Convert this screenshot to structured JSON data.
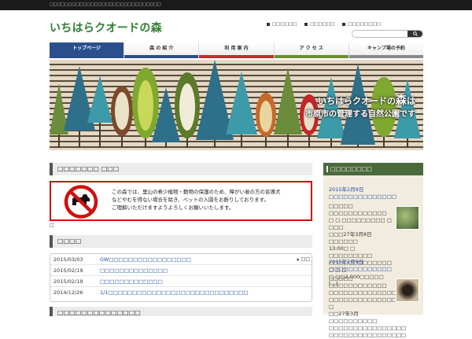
{
  "topbar": {
    "text": "□□□□□□□□□□□□□□□□□□□□□□□□□□□□□□"
  },
  "header": {
    "logo": {
      "part1": "いちはらクオードの",
      "part2": "森"
    },
    "links": [
      "□□□□□□",
      "□□□□□□",
      "□□□□□□□□"
    ],
    "search_placeholder": "",
    "search_icon": "magnifier-icon"
  },
  "nav": [
    {
      "label": "トップページ",
      "color": "#2b4f8c"
    },
    {
      "label": "森 の 紹 介",
      "color": "#2b4f8c"
    },
    {
      "label": "利 用 案 内",
      "color": "#c22e2e"
    },
    {
      "label": "ア ク セ ス",
      "color": "#6b8e2e"
    },
    {
      "label": "キャンプ場の予約",
      "color": "#8a8a8a"
    }
  ],
  "hero": {
    "tagline1_a": "いちはらクオードの",
    "tagline1_b": "森",
    "tagline1_c": "は",
    "tagline2": "市原市の管理する自然公園です"
  },
  "main": {
    "section1_title": "□□□□□□□ □□□",
    "notice": {
      "line1": "この森では、里山の希少植物・動物の保護のため、障がい者の方の盲導犬",
      "line2": "などやむを得ない場合を除き、ペットの入園をお断りしております。",
      "line3": "ご理解いただけますようよろしくお願いいたします。"
    },
    "small_box": "□",
    "news_title": "□□□□",
    "news_more": "□□",
    "news": [
      {
        "date": "2015/03/03",
        "title": "GW□□□□□□□□□□□□□□□□□"
      },
      {
        "date": "2015/02/19",
        "title": "□□□□□□□□□□□□□□"
      },
      {
        "date": "2015/02/19",
        "title": "□□□□□□□□□□□□□"
      },
      {
        "date": "2014/12/26",
        "title": "1/1□□□□□□□□□□□□□□□□□□□□□□□□□□□□□"
      }
    ],
    "section3_title": "□□□□□□□□□□□□□□"
  },
  "sidebar": {
    "title": "□□□□□□□□",
    "entries": [
      {
        "date": "2015年2月9日",
        "title": "□□□□□□□□□□□□□□",
        "body": [
          "□□□□□ □□□□□□□□□□□□",
          "□ □ □□□□□□□□□ □ □□□",
          "□□□27年3月8日□□□□□□",
          "13:00□ □ □□□□□□□□□",
          "□□□□□□□□□□□□□ □ □ □",
          "□ □□2,000□□□□□ [...]"
        ],
        "thumb_color": "#6e8a52"
      },
      {
        "date": "2015年2月9日",
        "title": "□□□□□□□□□□□□□",
        "body": [
          "□□□□□ □□□□□□□□□□□□",
          "□□□□□□□□□□□□□□□",
          "□□□□□□□□□□□□□□  □",
          "□□27年3月□□□□□□□□□□",
          "□□□□□□□□□□□□□□□□",
          "□□□□□□□□□□□□□□□□"
        ],
        "thumb_color": "#3b2f25"
      }
    ]
  }
}
